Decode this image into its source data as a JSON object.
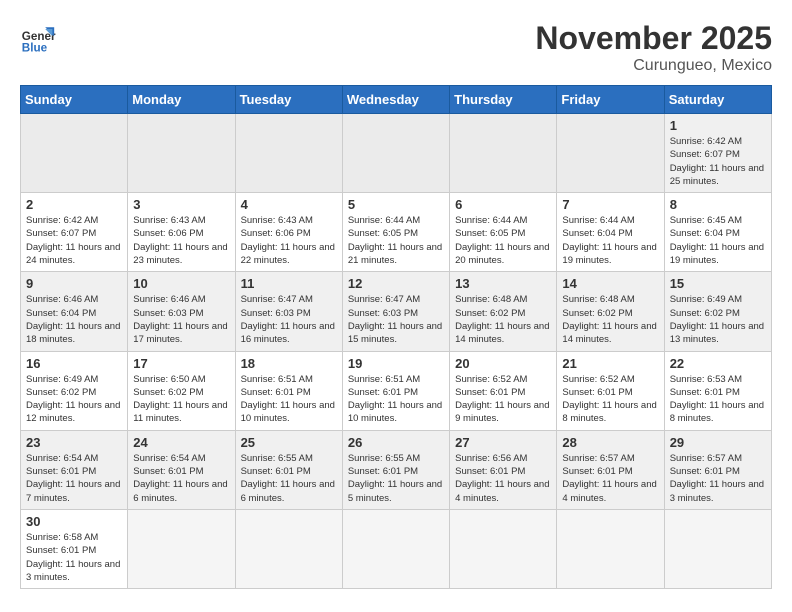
{
  "header": {
    "logo_general": "General",
    "logo_blue": "Blue",
    "month": "November 2025",
    "location": "Curungueo, Mexico"
  },
  "days_of_week": [
    "Sunday",
    "Monday",
    "Tuesday",
    "Wednesday",
    "Thursday",
    "Friday",
    "Saturday"
  ],
  "weeks": [
    [
      {
        "day": "",
        "empty": true
      },
      {
        "day": "",
        "empty": true
      },
      {
        "day": "",
        "empty": true
      },
      {
        "day": "",
        "empty": true
      },
      {
        "day": "",
        "empty": true
      },
      {
        "day": "",
        "empty": true
      },
      {
        "day": "1",
        "sunrise": "6:42 AM",
        "sunset": "6:07 PM",
        "daylight": "11 hours and 25 minutes."
      }
    ],
    [
      {
        "day": "2",
        "sunrise": "6:42 AM",
        "sunset": "6:07 PM",
        "daylight": "11 hours and 24 minutes."
      },
      {
        "day": "3",
        "sunrise": "6:43 AM",
        "sunset": "6:06 PM",
        "daylight": "11 hours and 23 minutes."
      },
      {
        "day": "4",
        "sunrise": "6:43 AM",
        "sunset": "6:06 PM",
        "daylight": "11 hours and 22 minutes."
      },
      {
        "day": "5",
        "sunrise": "6:44 AM",
        "sunset": "6:05 PM",
        "daylight": "11 hours and 21 minutes."
      },
      {
        "day": "6",
        "sunrise": "6:44 AM",
        "sunset": "6:05 PM",
        "daylight": "11 hours and 20 minutes."
      },
      {
        "day": "7",
        "sunrise": "6:44 AM",
        "sunset": "6:04 PM",
        "daylight": "11 hours and 19 minutes."
      },
      {
        "day": "8",
        "sunrise": "6:45 AM",
        "sunset": "6:04 PM",
        "daylight": "11 hours and 19 minutes."
      }
    ],
    [
      {
        "day": "9",
        "sunrise": "6:46 AM",
        "sunset": "6:04 PM",
        "daylight": "11 hours and 18 minutes."
      },
      {
        "day": "10",
        "sunrise": "6:46 AM",
        "sunset": "6:03 PM",
        "daylight": "11 hours and 17 minutes."
      },
      {
        "day": "11",
        "sunrise": "6:47 AM",
        "sunset": "6:03 PM",
        "daylight": "11 hours and 16 minutes."
      },
      {
        "day": "12",
        "sunrise": "6:47 AM",
        "sunset": "6:03 PM",
        "daylight": "11 hours and 15 minutes."
      },
      {
        "day": "13",
        "sunrise": "6:48 AM",
        "sunset": "6:02 PM",
        "daylight": "11 hours and 14 minutes."
      },
      {
        "day": "14",
        "sunrise": "6:48 AM",
        "sunset": "6:02 PM",
        "daylight": "11 hours and 14 minutes."
      },
      {
        "day": "15",
        "sunrise": "6:49 AM",
        "sunset": "6:02 PM",
        "daylight": "11 hours and 13 minutes."
      }
    ],
    [
      {
        "day": "16",
        "sunrise": "6:49 AM",
        "sunset": "6:02 PM",
        "daylight": "11 hours and 12 minutes."
      },
      {
        "day": "17",
        "sunrise": "6:50 AM",
        "sunset": "6:02 PM",
        "daylight": "11 hours and 11 minutes."
      },
      {
        "day": "18",
        "sunrise": "6:51 AM",
        "sunset": "6:01 PM",
        "daylight": "11 hours and 10 minutes."
      },
      {
        "day": "19",
        "sunrise": "6:51 AM",
        "sunset": "6:01 PM",
        "daylight": "11 hours and 10 minutes."
      },
      {
        "day": "20",
        "sunrise": "6:52 AM",
        "sunset": "6:01 PM",
        "daylight": "11 hours and 9 minutes."
      },
      {
        "day": "21",
        "sunrise": "6:52 AM",
        "sunset": "6:01 PM",
        "daylight": "11 hours and 8 minutes."
      },
      {
        "day": "22",
        "sunrise": "6:53 AM",
        "sunset": "6:01 PM",
        "daylight": "11 hours and 8 minutes."
      }
    ],
    [
      {
        "day": "23",
        "sunrise": "6:54 AM",
        "sunset": "6:01 PM",
        "daylight": "11 hours and 7 minutes."
      },
      {
        "day": "24",
        "sunrise": "6:54 AM",
        "sunset": "6:01 PM",
        "daylight": "11 hours and 6 minutes."
      },
      {
        "day": "25",
        "sunrise": "6:55 AM",
        "sunset": "6:01 PM",
        "daylight": "11 hours and 6 minutes."
      },
      {
        "day": "26",
        "sunrise": "6:55 AM",
        "sunset": "6:01 PM",
        "daylight": "11 hours and 5 minutes."
      },
      {
        "day": "27",
        "sunrise": "6:56 AM",
        "sunset": "6:01 PM",
        "daylight": "11 hours and 4 minutes."
      },
      {
        "day": "28",
        "sunrise": "6:57 AM",
        "sunset": "6:01 PM",
        "daylight": "11 hours and 4 minutes."
      },
      {
        "day": "29",
        "sunrise": "6:57 AM",
        "sunset": "6:01 PM",
        "daylight": "11 hours and 3 minutes."
      }
    ],
    [
      {
        "day": "30",
        "sunrise": "6:58 AM",
        "sunset": "6:01 PM",
        "daylight": "11 hours and 3 minutes."
      },
      {
        "day": "",
        "empty": true
      },
      {
        "day": "",
        "empty": true
      },
      {
        "day": "",
        "empty": true
      },
      {
        "day": "",
        "empty": true
      },
      {
        "day": "",
        "empty": true
      },
      {
        "day": "",
        "empty": true
      }
    ]
  ],
  "labels": {
    "sunrise": "Sunrise:",
    "sunset": "Sunset:",
    "daylight": "Daylight:"
  }
}
